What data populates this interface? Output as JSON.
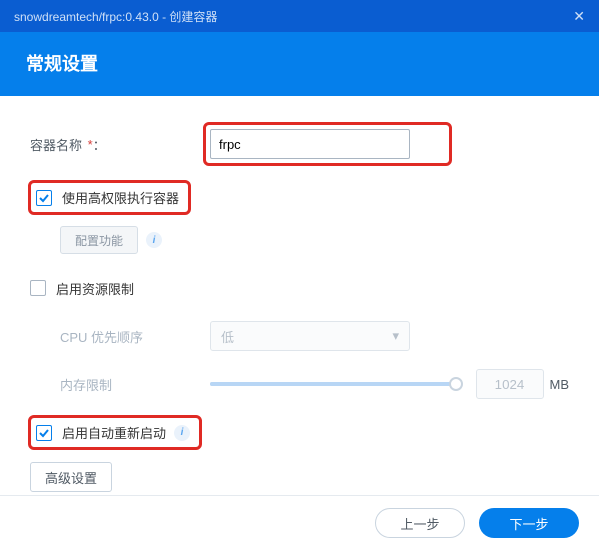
{
  "titleBar": {
    "text": "snowdreamtech/frpc:0.43.0 - 创建容器"
  },
  "header": {
    "title": "常规设置"
  },
  "form": {
    "containerName": {
      "label": "容器名称",
      "required": "*",
      "colon": "：",
      "value": "frpc"
    },
    "highPriv": {
      "label": "使用高权限执行容器",
      "checked": true
    },
    "configBtn": {
      "label": "配置功能"
    },
    "resourceLimit": {
      "label": "启用资源限制",
      "checked": false
    },
    "cpuPriority": {
      "label": "CPU 优先顺序",
      "value": "低"
    },
    "memLimit": {
      "label": "内存限制",
      "value": "1024",
      "unit": "MB"
    },
    "autoRestart": {
      "label": "启用自动重新启动",
      "checked": true
    },
    "advancedBtn": {
      "label": "高级设置"
    }
  },
  "footer": {
    "prev": "上一步",
    "next": "下一步"
  }
}
